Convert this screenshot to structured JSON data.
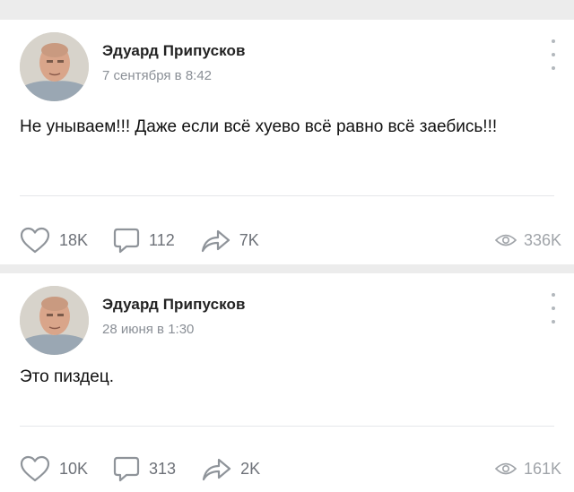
{
  "posts": [
    {
      "author": "Эдуард Припусков",
      "date": "7 сентября в 8:42",
      "text": "Не унываем!!! Даже если всё хуево всё равно всё заебись!!!",
      "likes": "18K",
      "comments": "112",
      "shares": "7K",
      "views": "336K"
    },
    {
      "author": "Эдуард Припусков",
      "date": "28 июня в 1:30",
      "text": "Это пиздец.",
      "likes": "10K",
      "comments": "313",
      "shares": "2K",
      "views": "161K"
    }
  ],
  "icons": {
    "like": "heart-icon",
    "comment": "comment-icon",
    "share": "share-icon",
    "views": "eye-icon",
    "menu": "more-vertical-icon"
  },
  "colors": {
    "icon_gray": "#8f949a",
    "views_gray": "#a0a4a9"
  }
}
